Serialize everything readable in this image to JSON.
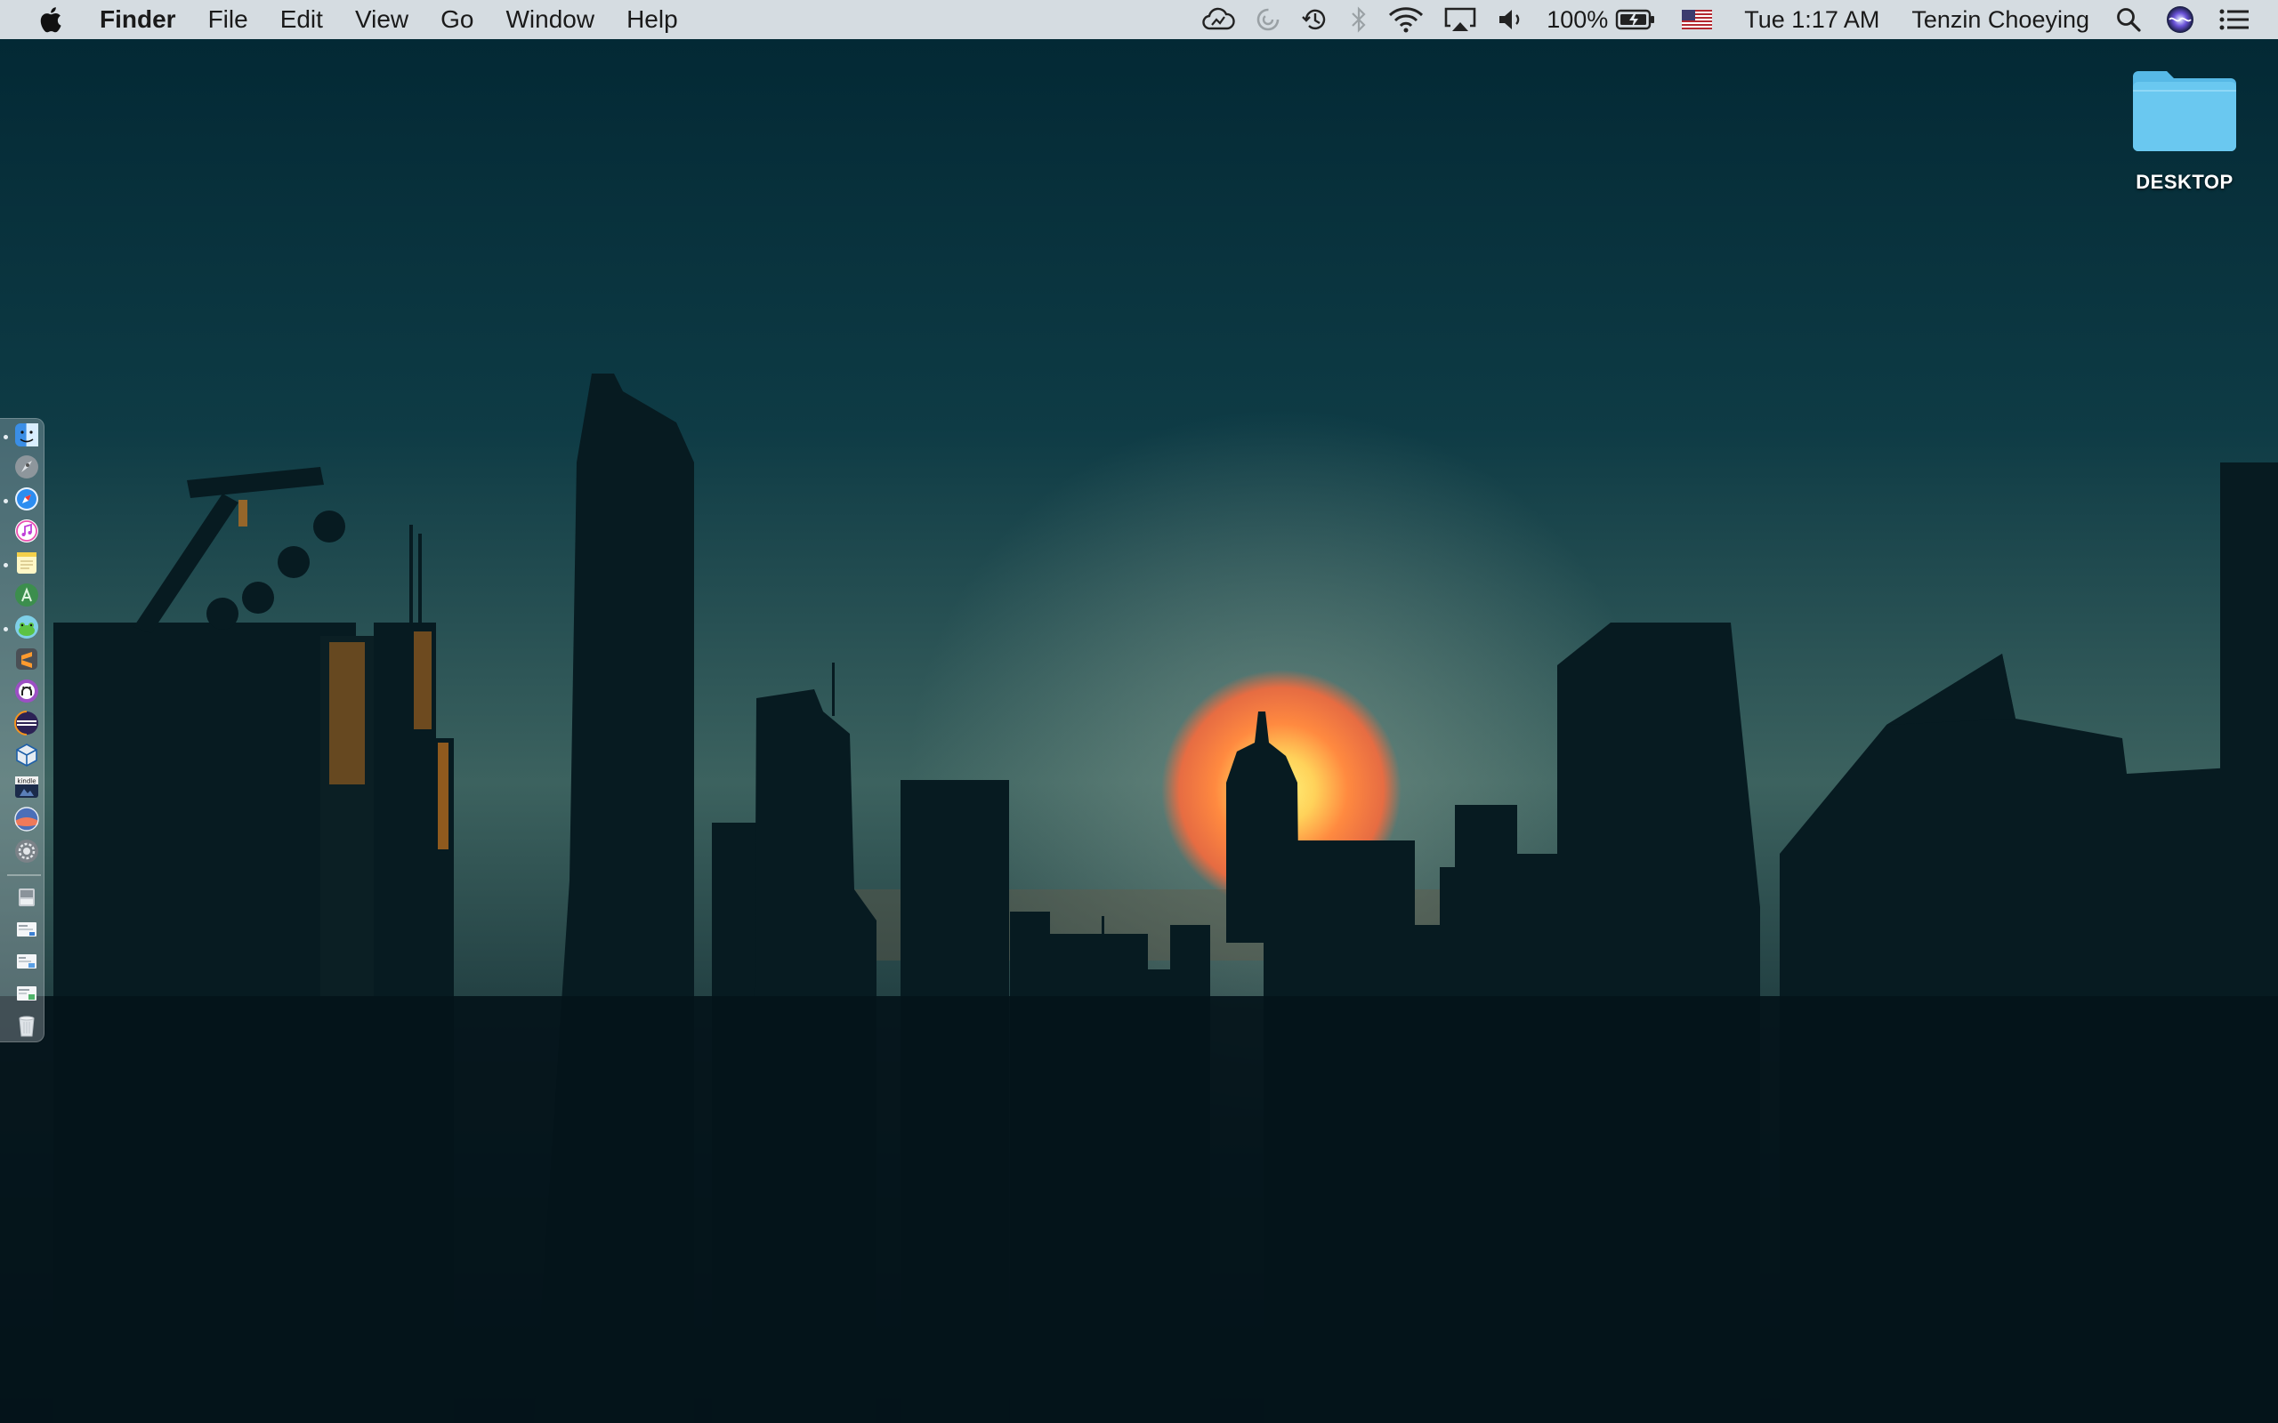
{
  "menubar": {
    "app_name": "Finder",
    "menus": [
      "File",
      "Edit",
      "View",
      "Go",
      "Window",
      "Help"
    ],
    "battery_percent": "100%",
    "clock": "Tue 1:17 AM",
    "user_name": "Tenzin Choeying"
  },
  "status_icons": [
    "cloud-sync-icon",
    "activity-spinner-icon",
    "time-machine-icon",
    "bluetooth-icon",
    "wifi-icon",
    "airplay-icon",
    "volume-icon",
    "battery-charging-icon",
    "us-flag-input-icon",
    "spotlight-search-icon",
    "siri-icon",
    "notification-center-icon"
  ],
  "desktop_items": [
    {
      "label": "DESKTOP",
      "icon": "folder-icon",
      "color": "#6ac8f0"
    }
  ],
  "dock": {
    "apps": [
      {
        "icon": "finder-icon",
        "running": true
      },
      {
        "icon": "launchpad-icon",
        "running": false
      },
      {
        "icon": "safari-icon",
        "running": true
      },
      {
        "icon": "itunes-icon",
        "running": false
      },
      {
        "icon": "notes-icon",
        "running": true
      },
      {
        "icon": "android-studio-icon",
        "running": false
      },
      {
        "icon": "frog-app-icon",
        "running": true
      },
      {
        "icon": "sublime-text-icon",
        "running": false
      },
      {
        "icon": "github-desktop-icon",
        "running": false
      },
      {
        "icon": "eclipse-icon",
        "running": false
      },
      {
        "icon": "virtualbox-icon",
        "running": false
      },
      {
        "icon": "kindle-icon",
        "label": "kindle",
        "running": false
      },
      {
        "icon": "macos-installer-icon",
        "running": false
      },
      {
        "icon": "system-preferences-icon",
        "running": false
      }
    ],
    "stacks": [
      {
        "icon": "downloads-stack-icon"
      },
      {
        "icon": "document-stack-icon"
      },
      {
        "icon": "screenshot-stack-icon"
      },
      {
        "icon": "image-stack-icon"
      },
      {
        "icon": "trash-icon"
      }
    ]
  },
  "colors": {
    "menubar_bg": "#e2e8ec",
    "sky_top": "#022c38",
    "sky_horizon": "#5a7e78",
    "sun": "#ff6a3a",
    "folder": "#6ac8f0"
  }
}
